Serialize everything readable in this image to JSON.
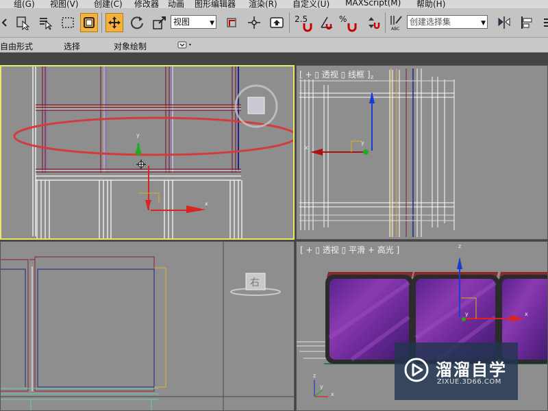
{
  "menu": [
    "组(G)",
    "视图(V)",
    "创建(C)",
    "修改器",
    "动画",
    "图形编辑器",
    "渲染(R)",
    "自定义(U)",
    "MAXScript(M)",
    "帮助(H)"
  ],
  "toolbar": {
    "reference_coord_label": "视图",
    "snap_angle_label": "2.5",
    "percent_label": "%",
    "named_selection_placeholder": "创建选择集",
    "abc_label": "ABC"
  },
  "ribbon": {
    "tabs": [
      "自由形式",
      "选择",
      "对象绘制"
    ]
  },
  "viewports": {
    "top_right_label": "[ + ▯ 透视 ▯ 线框 ]",
    "bottom_left_cube_label": "右",
    "bottom_right_label": "[ + ▯ 透视 ▯ 平滑 + 高光 ]",
    "gizmo_labels": {
      "x": "x",
      "y": "y",
      "z": "z"
    }
  },
  "watermark": {
    "title": "溜溜自学",
    "url": "ZIXUE.3D66.COM"
  },
  "colors": {
    "selection_ellipse": "#d33c3c",
    "active_viewport_border": "#e8e86a",
    "active_tool": "#f4b23c",
    "box_purple": "#7a2f9a"
  }
}
